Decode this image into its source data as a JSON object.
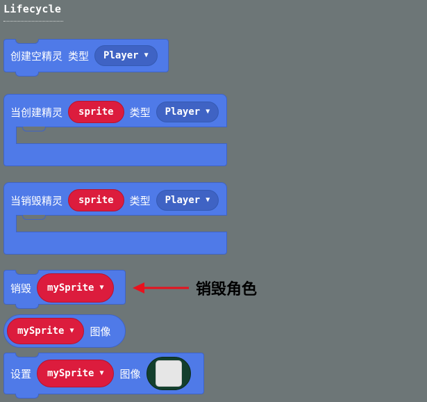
{
  "category": {
    "title": "Lifecycle"
  },
  "blocks": {
    "create_empty_sprite": {
      "label": "创建空精灵",
      "type_label": "类型",
      "kind": "Player"
    },
    "on_created": {
      "label": "当创建精灵",
      "var": "sprite",
      "type_label": "类型",
      "kind": "Player"
    },
    "on_destroyed": {
      "label": "当销毁精灵",
      "var": "sprite",
      "type_label": "类型",
      "kind": "Player"
    },
    "destroy": {
      "label": "销毁",
      "var": "mySprite"
    },
    "image_reporter": {
      "var": "mySprite",
      "label": "图像"
    },
    "set_image": {
      "label": "设置",
      "var": "mySprite",
      "image_label": "图像"
    }
  },
  "annotation": {
    "text": "销毁角色",
    "color": "#e8121e"
  },
  "colors": {
    "background": "#6d7677",
    "block": "#4f7ae8",
    "variable": "#dc1c3d"
  },
  "icons": {
    "dropdown": "caret-down-icon"
  }
}
